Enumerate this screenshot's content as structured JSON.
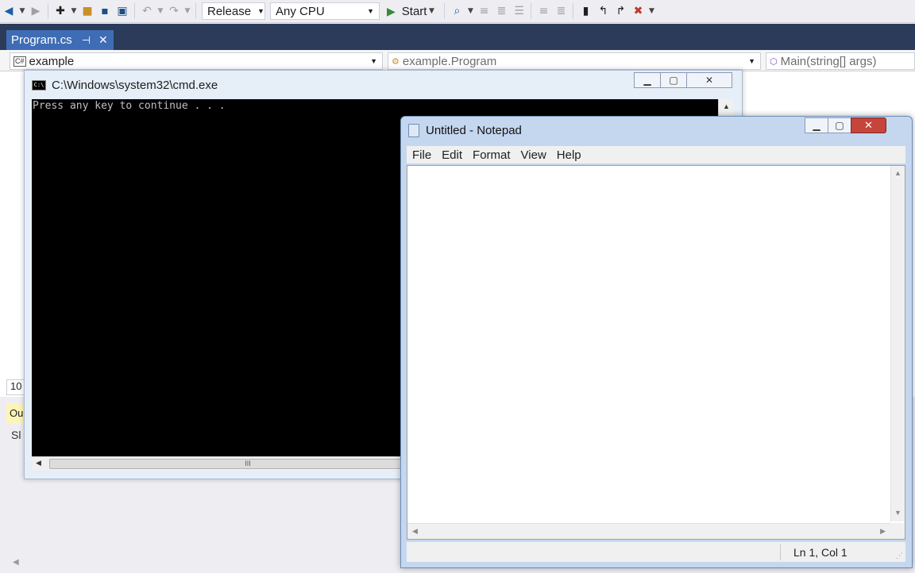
{
  "vs": {
    "toolbar": {
      "config_value": "Release",
      "platform_value": "Any CPU",
      "start_label": "Start",
      "icons": [
        "back-arrow-icon",
        "forward-arrow-icon",
        "new-project-icon",
        "open-file-icon",
        "save-icon",
        "save-all-icon",
        "undo-icon",
        "redo-icon",
        "play-icon",
        "find-icon",
        "comment-icon",
        "uncomment-icon",
        "bookmark-icon",
        "prev-bookmark-icon",
        "next-bookmark-icon",
        "clear-bookmarks-icon"
      ]
    },
    "tab": {
      "label": "Program.cs"
    },
    "navbar": {
      "project_badge": "C#",
      "project": "example",
      "type": "example.Program",
      "member": "Main(string[] args)"
    },
    "zoom_value": "10",
    "output_tab_label": "Ou",
    "side_label": "Sl"
  },
  "cmd": {
    "icon_text": "C:\\",
    "title": "C:\\Windows\\system32\\cmd.exe",
    "output": "Press any key to continue . . .",
    "scroll_thumb_grip": "III"
  },
  "notepad": {
    "title": "Untitled - Notepad",
    "menu": [
      "File",
      "Edit",
      "Format",
      "View",
      "Help"
    ],
    "content": "",
    "status": "Ln 1, Col 1"
  },
  "colors": {
    "vs_tab_band": "#2b3b59",
    "vs_tab_active": "#3e6db5",
    "start_green": "#388a34",
    "notepad_close_red": "#c5453b",
    "console_bg": "#000000"
  }
}
